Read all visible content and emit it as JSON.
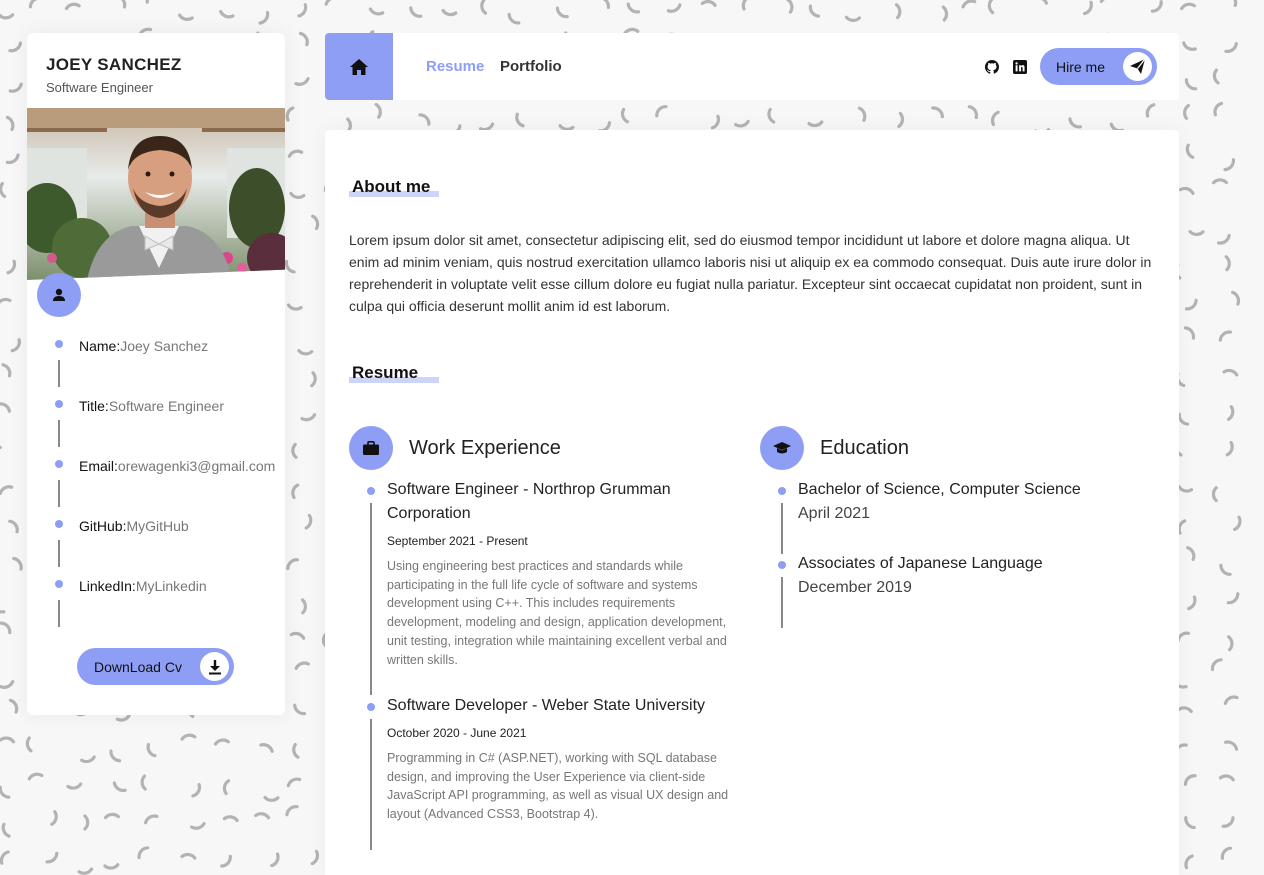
{
  "profile": {
    "name": "JOEY SANCHEZ",
    "title": "Software Engineer",
    "info": [
      {
        "label": "Name:",
        "value": "Joey Sanchez"
      },
      {
        "label": "Title:",
        "value": "Software Engineer"
      },
      {
        "label": "Email:",
        "value": "orewagenki3@gmail.com"
      },
      {
        "label": "GitHub:",
        "value": "MyGitHub"
      },
      {
        "label": "LinkedIn:",
        "value": "MyLinkedin"
      }
    ],
    "download_label": "DownLoad Cv"
  },
  "nav": {
    "links": [
      "Resume",
      "Portfolio"
    ],
    "active": "Resume",
    "hire_label": "Hire me"
  },
  "about": {
    "heading": "About me",
    "text": "Lorem ipsum dolor sit amet, consectetur adipiscing elit, sed do eiusmod tempor incididunt ut labore et dolore magna aliqua. Ut enim ad minim veniam, quis nostrud exercitation ullamco laboris nisi ut aliquip ex ea commodo consequat. Duis aute irure dolor in reprehenderit in voluptate velit esse cillum dolore eu fugiat nulla pariatur. Excepteur sint occaecat cupidatat non proident, sunt in culpa qui officia deserunt mollit anim id est laborum."
  },
  "resume": {
    "heading": "Resume",
    "work": {
      "heading": "Work Experience",
      "entries": [
        {
          "title": "Software Engineer - Northrop Grumman Corporation",
          "date": "September 2021 - Present",
          "desc": "Using engineering best practices and standards while participating in the full life cycle of software and systems development using C++. This includes requirements development, modeling and design, application development, unit testing, integration while maintaining excellent verbal and written skills."
        },
        {
          "title": "Software Developer - Weber State University",
          "date": "October 2020 - June 2021",
          "desc": "Programming in C# (ASP.NET), working with SQL database design, and improving the User Experience via client-side JavaScript API programming, as well as visual UX design and layout (Advanced CSS3, Bootstrap 4)."
        }
      ]
    },
    "education": {
      "heading": "Education",
      "entries": [
        {
          "title": "Bachelor of Science, Computer Science",
          "date": "April 2021"
        },
        {
          "title": "Associates of Japanese Language",
          "date": "December 2019"
        }
      ]
    }
  },
  "colors": {
    "accent": "#8e9ef5",
    "accent_light": "#cdd4fa",
    "text": "#222222",
    "muted": "#777777"
  },
  "icons": [
    "home-icon",
    "user-icon",
    "download-icon",
    "github-icon",
    "linkedin-icon",
    "send-icon",
    "briefcase-icon",
    "graduation-cap-icon"
  ]
}
